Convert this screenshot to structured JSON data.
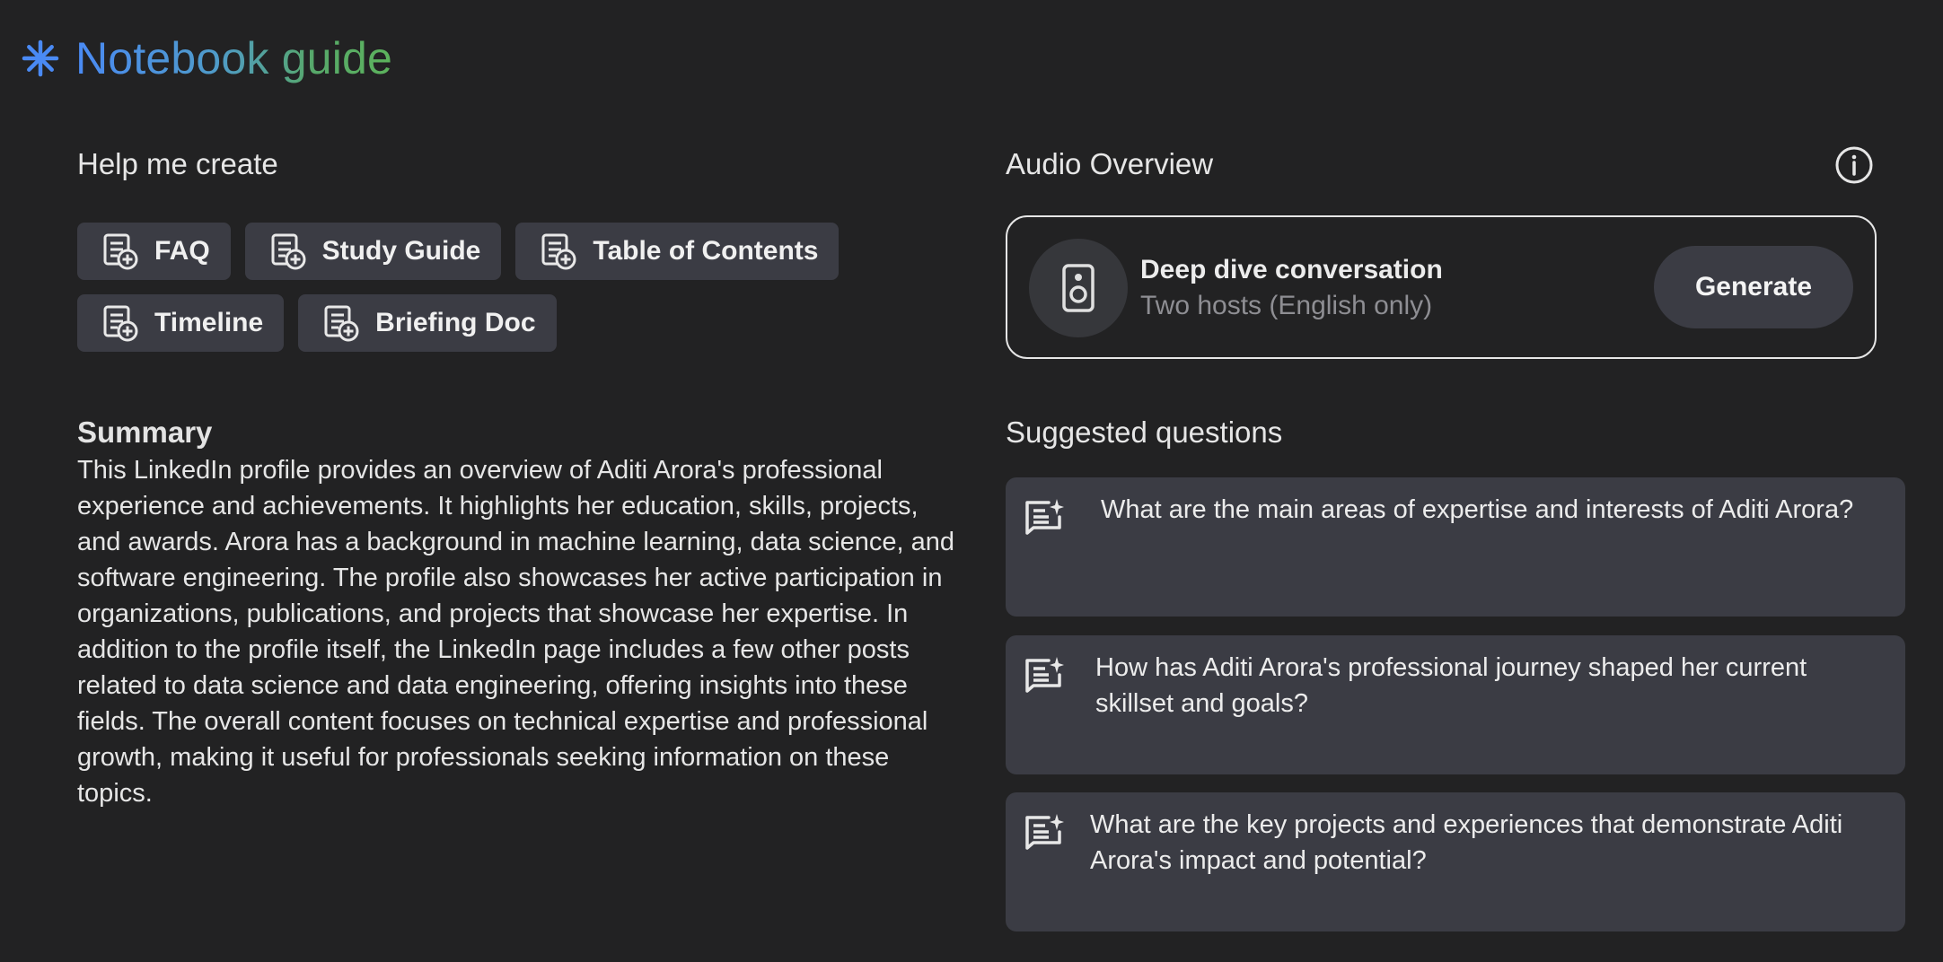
{
  "header": {
    "title": "Notebook guide",
    "icon": "sparkle-icon"
  },
  "help_me_create": {
    "heading": "Help me create",
    "chips_row1": [
      {
        "label": "FAQ",
        "icon": "note-add-icon"
      },
      {
        "label": "Study Guide",
        "icon": "note-add-icon"
      },
      {
        "label": "Table of Contents",
        "icon": "note-add-icon"
      }
    ],
    "chips_row2": [
      {
        "label": "Timeline",
        "icon": "note-add-icon"
      },
      {
        "label": "Briefing Doc",
        "icon": "note-add-icon"
      }
    ]
  },
  "summary": {
    "heading": "Summary",
    "text": "This LinkedIn profile provides an overview of Aditi Arora's professional experience and achievements. It highlights her education, skills, projects, and awards. Arora has a background in machine learning, data science, and software engineering. The profile also showcases her active participation in organizations, publications, and projects that showcase her expertise. In addition to the profile itself, the LinkedIn page includes a few other posts related to data science and data engineering, offering insights into these fields. The overall content focuses on technical expertise and professional growth, making it useful for professionals seeking information on these topics."
  },
  "audio_overview": {
    "heading": "Audio Overview",
    "info_icon": "info-icon",
    "card": {
      "icon": "speaker-icon",
      "title": "Deep dive conversation",
      "subtitle": "Two hosts (English only)",
      "button_label": "Generate"
    }
  },
  "suggested_questions": {
    "heading": "Suggested questions",
    "items": [
      {
        "text": "What are the main areas of expertise and interests of Aditi Arora?",
        "icon": "chat-spark-icon"
      },
      {
        "text": "How has Aditi Arora's professional journey shaped her current skillset and goals?",
        "icon": "chat-spark-icon"
      },
      {
        "text": "What are the key projects and experiences that demonstrate Aditi Arora's impact and potential?",
        "icon": "chat-spark-icon"
      }
    ]
  },
  "colors": {
    "background": "#222223",
    "chip_background": "#3b3c44",
    "title_gradient_start": "#4a8af4",
    "title_gradient_end": "#5cb35c",
    "subtitle_gray": "#8e8e93"
  }
}
